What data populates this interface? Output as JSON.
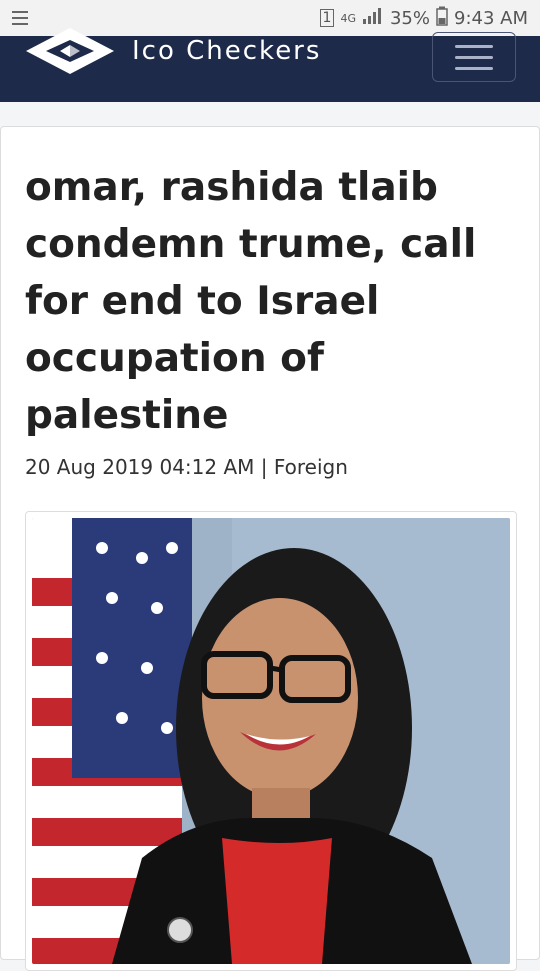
{
  "status_bar": {
    "network": "4G",
    "battery": "35%",
    "time": "9:43 AM"
  },
  "navbar": {
    "brand": "Ico Checkers"
  },
  "article": {
    "title": "omar, rashida tlaib condemn trume, call for end to Israel occupation of palestine",
    "date": "20 Aug 2019 04:12 AM",
    "separator": " | ",
    "category": "Foreign"
  },
  "colors": {
    "navbar_bg": "#1e2a4a",
    "page_bg": "#f4f5f7"
  },
  "icons": [
    "list-icon",
    "signal-icon",
    "battery-icon",
    "logo-icon",
    "hamburger-icon"
  ]
}
